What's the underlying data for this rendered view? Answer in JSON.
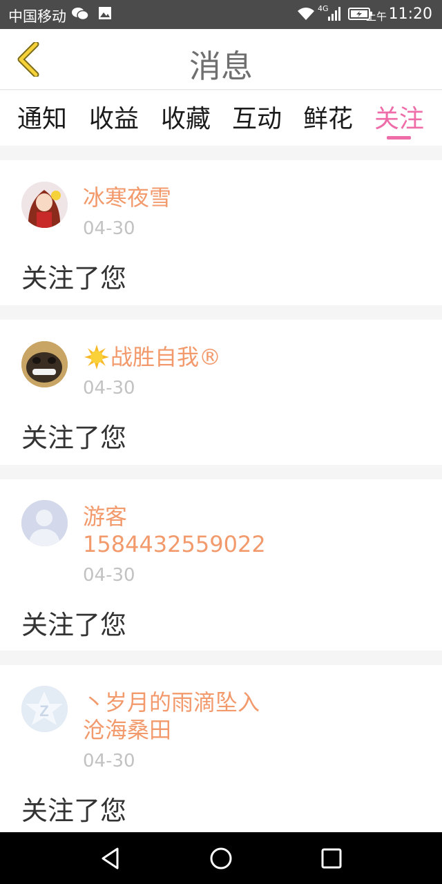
{
  "status_bar": {
    "carrier": "中国移动",
    "network": "4G",
    "ampm": "上午",
    "time": "11:20"
  },
  "header": {
    "title": "消息"
  },
  "tabs": [
    {
      "label": "通知",
      "active": false
    },
    {
      "label": "收益",
      "active": false
    },
    {
      "label": "收藏",
      "active": false
    },
    {
      "label": "互动",
      "active": false
    },
    {
      "label": "鲜花",
      "active": false
    },
    {
      "label": "关注",
      "active": true
    }
  ],
  "colors": {
    "accent": "#ee6ca8",
    "username": "#f29a6c",
    "date": "#c2c2c2"
  },
  "items": [
    {
      "name_lines": [
        "冰寒夜雪"
      ],
      "date": "04-30",
      "message": "关注了您",
      "avatar": "anime-girl-avatar"
    },
    {
      "name_lines": [
        "战胜自我®"
      ],
      "name_prefix_icon": "sun-emoji-icon",
      "date": "04-30",
      "message": "关注了您",
      "avatar": "pug-avatar"
    },
    {
      "name_lines": [
        "游客",
        "1584432559022"
      ],
      "date": "04-30",
      "message": "关注了您",
      "avatar": "default-user-avatar"
    },
    {
      "name_lines": [
        "丶岁月的雨滴坠入",
        "沧海桑田"
      ],
      "date": "04-30",
      "message": "关注了您",
      "avatar": "qzone-avatar"
    }
  ]
}
